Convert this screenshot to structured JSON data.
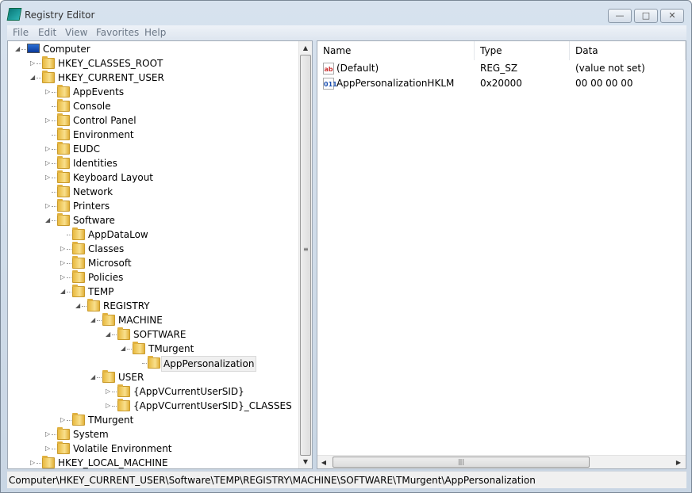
{
  "window": {
    "title": "Registry Editor",
    "controls": {
      "minimize": "—",
      "maximize": "□",
      "close": "✕"
    }
  },
  "menu": [
    "File",
    "Edit",
    "View",
    "Favorites",
    "Help"
  ],
  "tree": [
    {
      "label": "Computer",
      "level": 0,
      "state": "expanded",
      "icon": "computer-icon"
    },
    {
      "label": "HKEY_CLASSES_ROOT",
      "level": 1,
      "state": "collapsed"
    },
    {
      "label": "HKEY_CURRENT_USER",
      "level": 1,
      "state": "expanded"
    },
    {
      "label": "AppEvents",
      "level": 2,
      "state": "collapsed"
    },
    {
      "label": "Console",
      "level": 2,
      "state": "leaf"
    },
    {
      "label": "Control Panel",
      "level": 2,
      "state": "collapsed"
    },
    {
      "label": "Environment",
      "level": 2,
      "state": "leaf"
    },
    {
      "label": "EUDC",
      "level": 2,
      "state": "collapsed"
    },
    {
      "label": "Identities",
      "level": 2,
      "state": "collapsed"
    },
    {
      "label": "Keyboard Layout",
      "level": 2,
      "state": "collapsed"
    },
    {
      "label": "Network",
      "level": 2,
      "state": "leaf"
    },
    {
      "label": "Printers",
      "level": 2,
      "state": "collapsed"
    },
    {
      "label": "Software",
      "level": 2,
      "state": "expanded"
    },
    {
      "label": "AppDataLow",
      "level": 3,
      "state": "leaf"
    },
    {
      "label": "Classes",
      "level": 3,
      "state": "collapsed"
    },
    {
      "label": "Microsoft",
      "level": 3,
      "state": "collapsed"
    },
    {
      "label": "Policies",
      "level": 3,
      "state": "collapsed"
    },
    {
      "label": "TEMP",
      "level": 3,
      "state": "expanded"
    },
    {
      "label": "REGISTRY",
      "level": 4,
      "state": "expanded"
    },
    {
      "label": "MACHINE",
      "level": 5,
      "state": "expanded"
    },
    {
      "label": "SOFTWARE",
      "level": 6,
      "state": "expanded"
    },
    {
      "label": "TMurgent",
      "level": 7,
      "state": "expanded"
    },
    {
      "label": "AppPersonalization",
      "level": 8,
      "state": "leaf",
      "selected": true
    },
    {
      "label": "USER",
      "level": 5,
      "state": "expanded"
    },
    {
      "label": "{AppVCurrentUserSID}",
      "level": 6,
      "state": "collapsed"
    },
    {
      "label": "{AppVCurrentUserSID}_CLASSES",
      "level": 6,
      "state": "collapsed"
    },
    {
      "label": "TMurgent",
      "level": 3,
      "state": "collapsed"
    },
    {
      "label": "System",
      "level": 2,
      "state": "collapsed"
    },
    {
      "label": "Volatile Environment",
      "level": 2,
      "state": "collapsed"
    },
    {
      "label": "HKEY_LOCAL_MACHINE",
      "level": 1,
      "state": "collapsed"
    }
  ],
  "values": {
    "columns": {
      "name": "Name",
      "type": "Type",
      "data": "Data"
    },
    "rows": [
      {
        "icon": "string-value-icon",
        "icon_text": "ab",
        "name": "(Default)",
        "type": "REG_SZ",
        "data": "(value not set)"
      },
      {
        "icon": "binary-value-icon",
        "icon_text": "011",
        "name": "AppPersonalizationHKLM",
        "type": "0x20000",
        "data": "00 00 00 00"
      }
    ]
  },
  "status": "Computer\\HKEY_CURRENT_USER\\Software\\TEMP\\REGISTRY\\MACHINE\\SOFTWARE\\TMurgent\\AppPersonalization"
}
